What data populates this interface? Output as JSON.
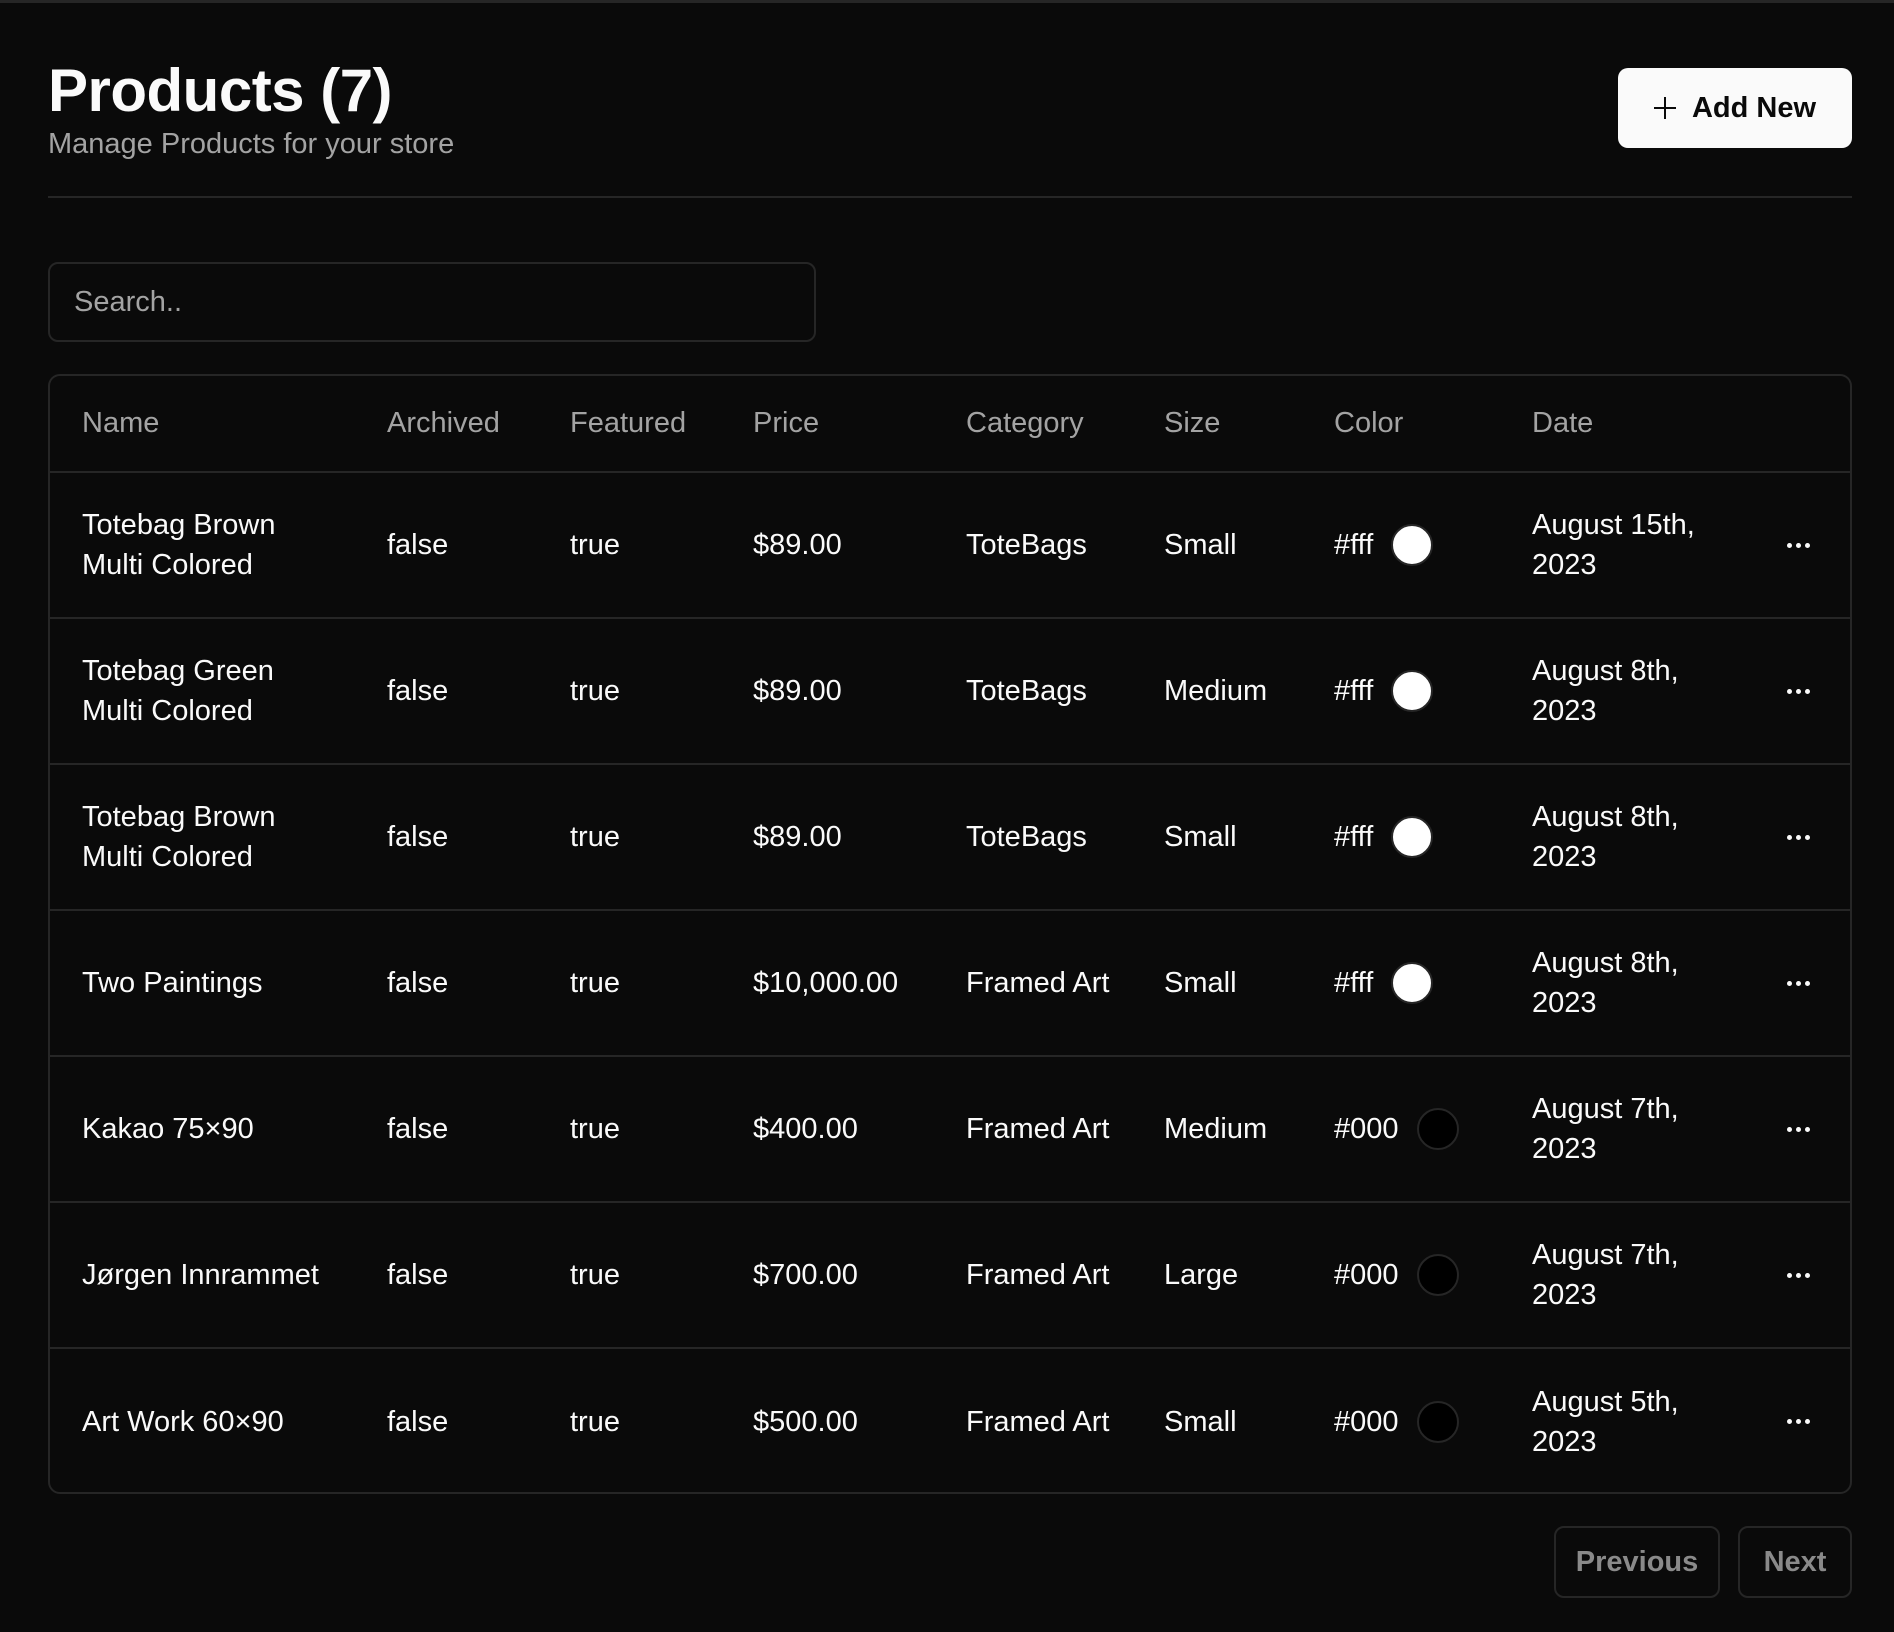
{
  "header": {
    "title": "Products (7)",
    "subtitle": "Manage Products for your store",
    "add_label": "Add New"
  },
  "search": {
    "placeholder": "Search.."
  },
  "table": {
    "columns": [
      "Name",
      "Archived",
      "Featured",
      "Price",
      "Category",
      "Size",
      "Color",
      "Date"
    ],
    "rows": [
      {
        "name": "Totebag Brown Multi Colored",
        "archived": "false",
        "featured": "true",
        "price": "$89.00",
        "category": "ToteBags",
        "size": "Small",
        "color": "#fff",
        "date": "August 15th, 2023"
      },
      {
        "name": "Totebag Green Multi Colored",
        "archived": "false",
        "featured": "true",
        "price": "$89.00",
        "category": "ToteBags",
        "size": "Medium",
        "color": "#fff",
        "date": "August 8th, 2023"
      },
      {
        "name": "Totebag Brown Multi Colored",
        "archived": "false",
        "featured": "true",
        "price": "$89.00",
        "category": "ToteBags",
        "size": "Small",
        "color": "#fff",
        "date": "August 8th, 2023"
      },
      {
        "name": "Two Paintings",
        "archived": "false",
        "featured": "true",
        "price": "$10,000.00",
        "category": "Framed Art",
        "size": "Small",
        "color": "#fff",
        "date": "August 8th, 2023"
      },
      {
        "name": "Kakao 75×90",
        "archived": "false",
        "featured": "true",
        "price": "$400.00",
        "category": "Framed Art",
        "size": "Medium",
        "color": "#000",
        "date": "August 7th, 2023"
      },
      {
        "name": "Jørgen Innrammet",
        "archived": "false",
        "featured": "true",
        "price": "$700.00",
        "category": "Framed Art",
        "size": "Large",
        "color": "#000",
        "date": "August 7th, 2023"
      },
      {
        "name": "Art Work 60×90",
        "archived": "false",
        "featured": "true",
        "price": "$500.00",
        "category": "Framed Art",
        "size": "Small",
        "color": "#000",
        "date": "August 5th, 2023"
      }
    ]
  },
  "pagination": {
    "previous_label": "Previous",
    "next_label": "Next"
  },
  "theme": {
    "background": "#0a0a0a",
    "foreground": "#fafafa",
    "muted": "#a3a3a3",
    "border": "#262626"
  }
}
